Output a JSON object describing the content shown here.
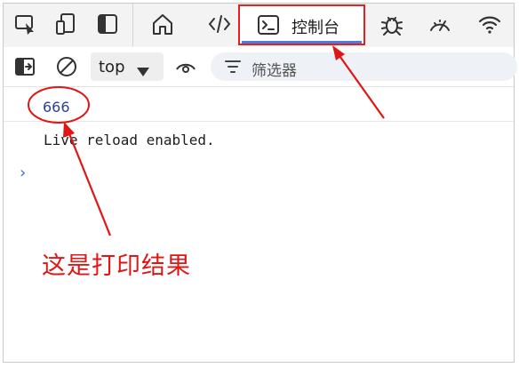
{
  "tabs": {
    "console_label": "控制台"
  },
  "toolbar": {
    "context_value": "top",
    "filter_placeholder": "筛选器"
  },
  "console": {
    "log_value": "666",
    "log_message": "Live reload enabled.",
    "prompt_symbol": "›"
  },
  "annotation": {
    "text": "这是打印结果",
    "color": "#e01616"
  },
  "colors": {
    "accent": "#4a7be0",
    "highlight_border": "#e22020",
    "log_value": "#2a3e9a"
  }
}
